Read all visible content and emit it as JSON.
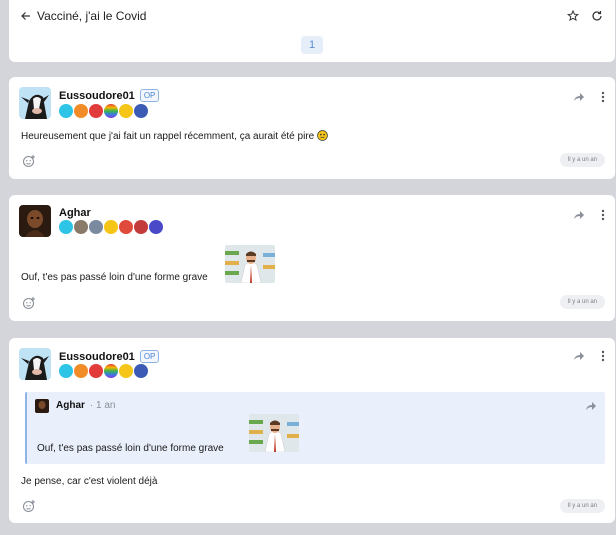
{
  "topic": {
    "title": "Vacciné, j'ai le Covid",
    "page_number": "1",
    "icons": [
      "back-arrow-icon",
      "star-icon",
      "refresh-icon"
    ]
  },
  "posts": [
    {
      "author": "Eussoudore01",
      "op_badge": "OP",
      "text": "Heureusement que j'ai fait un rappel récemment, ça aurait été pire",
      "time": "Il y a un an",
      "badge_colors": [
        "#2ec4e6",
        "#f28c28",
        "#e23b3b",
        "#f5b700",
        "#f5c518",
        "#3b5bb5"
      ]
    },
    {
      "author": "Aghar",
      "text": "Ouf, t'es pas passé loin d'une forme grave",
      "time": "Il y a un an",
      "badge_colors": [
        "#2ec4e6",
        "#8a7a6a",
        "#7a8aa0",
        "#f5c518",
        "#e04a3a",
        "#c43b3b",
        "#4a4ac8"
      ]
    },
    {
      "author": "Eussoudore01",
      "op_badge": "OP",
      "text": "Je pense, car c'est violent déjà",
      "time": "Il y a un an",
      "badge_colors": [
        "#2ec4e6",
        "#f28c28",
        "#e23b3b",
        "#f5b700",
        "#f5c518",
        "#3b5bb5"
      ],
      "quote": {
        "author": "Aghar",
        "time": "· 1 an",
        "text": "Ouf, t'es pas passé loin d'une forme grave"
      }
    }
  ]
}
